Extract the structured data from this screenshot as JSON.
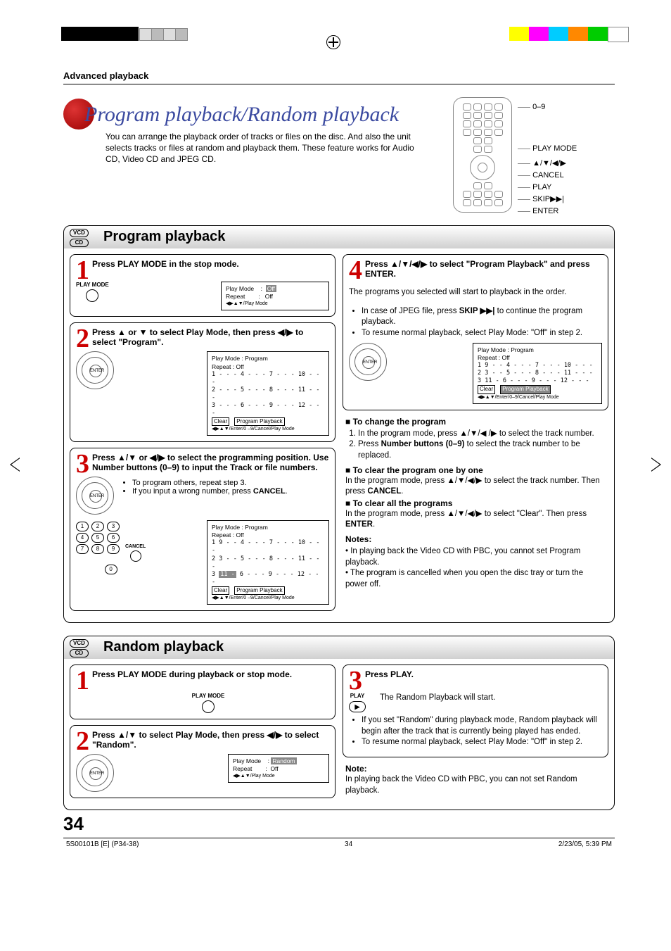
{
  "chapter": "Advanced playback",
  "title": "Program playback/Random playback",
  "intro": "You can arrange the playback order of tracks or files on the disc. And also the unit selects tracks or files at random and playback them. These feature works for Audio CD, Video CD and JPEG CD.",
  "remote_labels": [
    "0–9",
    "PLAY MODE",
    "▲/▼/◀/▶",
    "CANCEL",
    "PLAY",
    "SKIP▶▶|",
    "ENTER"
  ],
  "sections": {
    "program": {
      "badge_top": "VCD",
      "badge_bot": "CD",
      "heading": "Program playback"
    },
    "random": {
      "badge_top": "VCD",
      "badge_bot": "CD",
      "heading": "Random playback"
    }
  },
  "program_steps": {
    "s1": {
      "num": "1",
      "title": "Press PLAY MODE in the stop mode.",
      "icon_label": "PLAY MODE",
      "osd": {
        "l1a": "Play Mode",
        "l1b": ":",
        "l1c": "Off",
        "l2a": "Repeat",
        "l2b": ":",
        "l2c": "Off",
        "foot": "◀▶▲▼/Play Mode"
      }
    },
    "s2": {
      "num": "2",
      "title": "Press ▲ or ▼ to select Play Mode, then press ◀/▶ to select \"Program\".",
      "osd": {
        "l1": "Play Mode     :  Program",
        "l2": "Repeat          :  Off",
        "r1": "1 - - -   4 - - -   7 - - -   10 - - -",
        "r2": "2 - - -   5 - - -   8 - - -   11 - - -",
        "r3": "3 - - -   6 - - -   9 - - -   12 - - -",
        "clear": "Clear",
        "prog": "Program Playback",
        "foot": "◀▶▲▼/Enter/0 –9/Cancel/Play Mode"
      }
    },
    "s3": {
      "num": "3",
      "title": "Press ▲/▼ or ◀/▶ to select the programming position. Use Number buttons (0–9) to input the Track or file numbers.",
      "bullets": [
        "To program others, repeat step 3.",
        "If you input a wrong number, press CANCEL."
      ],
      "cancel_word": "CANCEL",
      "numpad_cancel": "CANCEL",
      "osd": {
        "l1": "Play Mode     :  Program",
        "l2": "Repeat          :  Off",
        "r1": "1 9 - -   4 - - -   7 - - -   10 - - -",
        "r2": "2 3 - -   5 - - -   8 - - -   11 - - -",
        "r3_pre": "3 ",
        "r3_hl": "11 -",
        "r3_post": "   6 - - -   9 - - -   12 - - -",
        "clear": "Clear",
        "prog": "Program Playback",
        "foot": "◀▶▲▼/Enter/0 –9/Cancel/Play Mode"
      }
    },
    "s4": {
      "num": "4",
      "title": "Press ▲/▼/◀/▶ to select \"Program Playback\" and press ENTER.",
      "para": "The programs you selected will start to playback in the order.",
      "bullets": [
        "In case of JPEG file, press SKIP ▶▶| to continue the program playback.",
        "To resume normal playback, select Play Mode: \"Off\" in step 2."
      ],
      "osd": {
        "l1": "Play Mode     :  Program",
        "l2": "Repeat          :  Off",
        "r1": "1 9 - -   4 - - -   7 - - -   10 - - -",
        "r2": "2 3 - -   5 - - -   8 - - -   11 - - -",
        "r3": "3 11 -   6 - - -   9 - - -   12 - - -",
        "clear": "Clear",
        "prog": "Program Playback",
        "foot": "◀▶▲▼/Enter/0–9/Cancel/Play Mode"
      }
    }
  },
  "program_extra": {
    "h1": "To change the program",
    "li1": "In the program mode, press ▲/▼/◀ /▶ to select the track number.",
    "li2_pre": "Press ",
    "li2_bold": "Number buttons (0–9)",
    "li2_post": " to select the track number to be replaced.",
    "h2": "To clear the program one by one",
    "p2": "In the program mode, press ▲/▼/◀/▶ to select the track number. Then press CANCEL.",
    "h3": "To clear all the programs",
    "p3": "In the program mode, press ▲/▼/◀/▶ to select \"Clear\". Then press ENTER.",
    "notes_h": "Notes:",
    "n1": "In playing back the Video CD with PBC, you cannot set Program playback.",
    "n2": "The program is cancelled when you open the disc tray or turn the power off."
  },
  "random_steps": {
    "s1": {
      "num": "1",
      "title": "Press PLAY MODE during playback or stop mode.",
      "icon_label": "PLAY MODE"
    },
    "s2": {
      "num": "2",
      "title": "Press ▲/▼ to select Play Mode, then press ◀/▶ to select \"Random\".",
      "osd": {
        "l1a": "Play Mode",
        "l1b": ":",
        "l1c": "Random",
        "l2a": "Repeat",
        "l2b": ":",
        "l2c": "Off",
        "foot": "◀▶▲▼/Play Mode"
      }
    },
    "s3": {
      "num": "3",
      "title": "Press PLAY.",
      "icon_label": "PLAY",
      "para": "The Random Playback will start.",
      "bullets": [
        "If you set \"Random\" during playback mode, Random playback will begin after the track that is currently being played has ended.",
        "To resume normal playback, select Play Mode: \"Off\" in step 2."
      ]
    }
  },
  "random_note": {
    "h": "Note:",
    "p": "In playing back the Video CD with PBC, you can not set Random playback."
  },
  "page_number": "34",
  "footer": {
    "left": "5S00101B [E] (P34-38)",
    "mid": "34",
    "right": "2/23/05, 5:39 PM"
  }
}
